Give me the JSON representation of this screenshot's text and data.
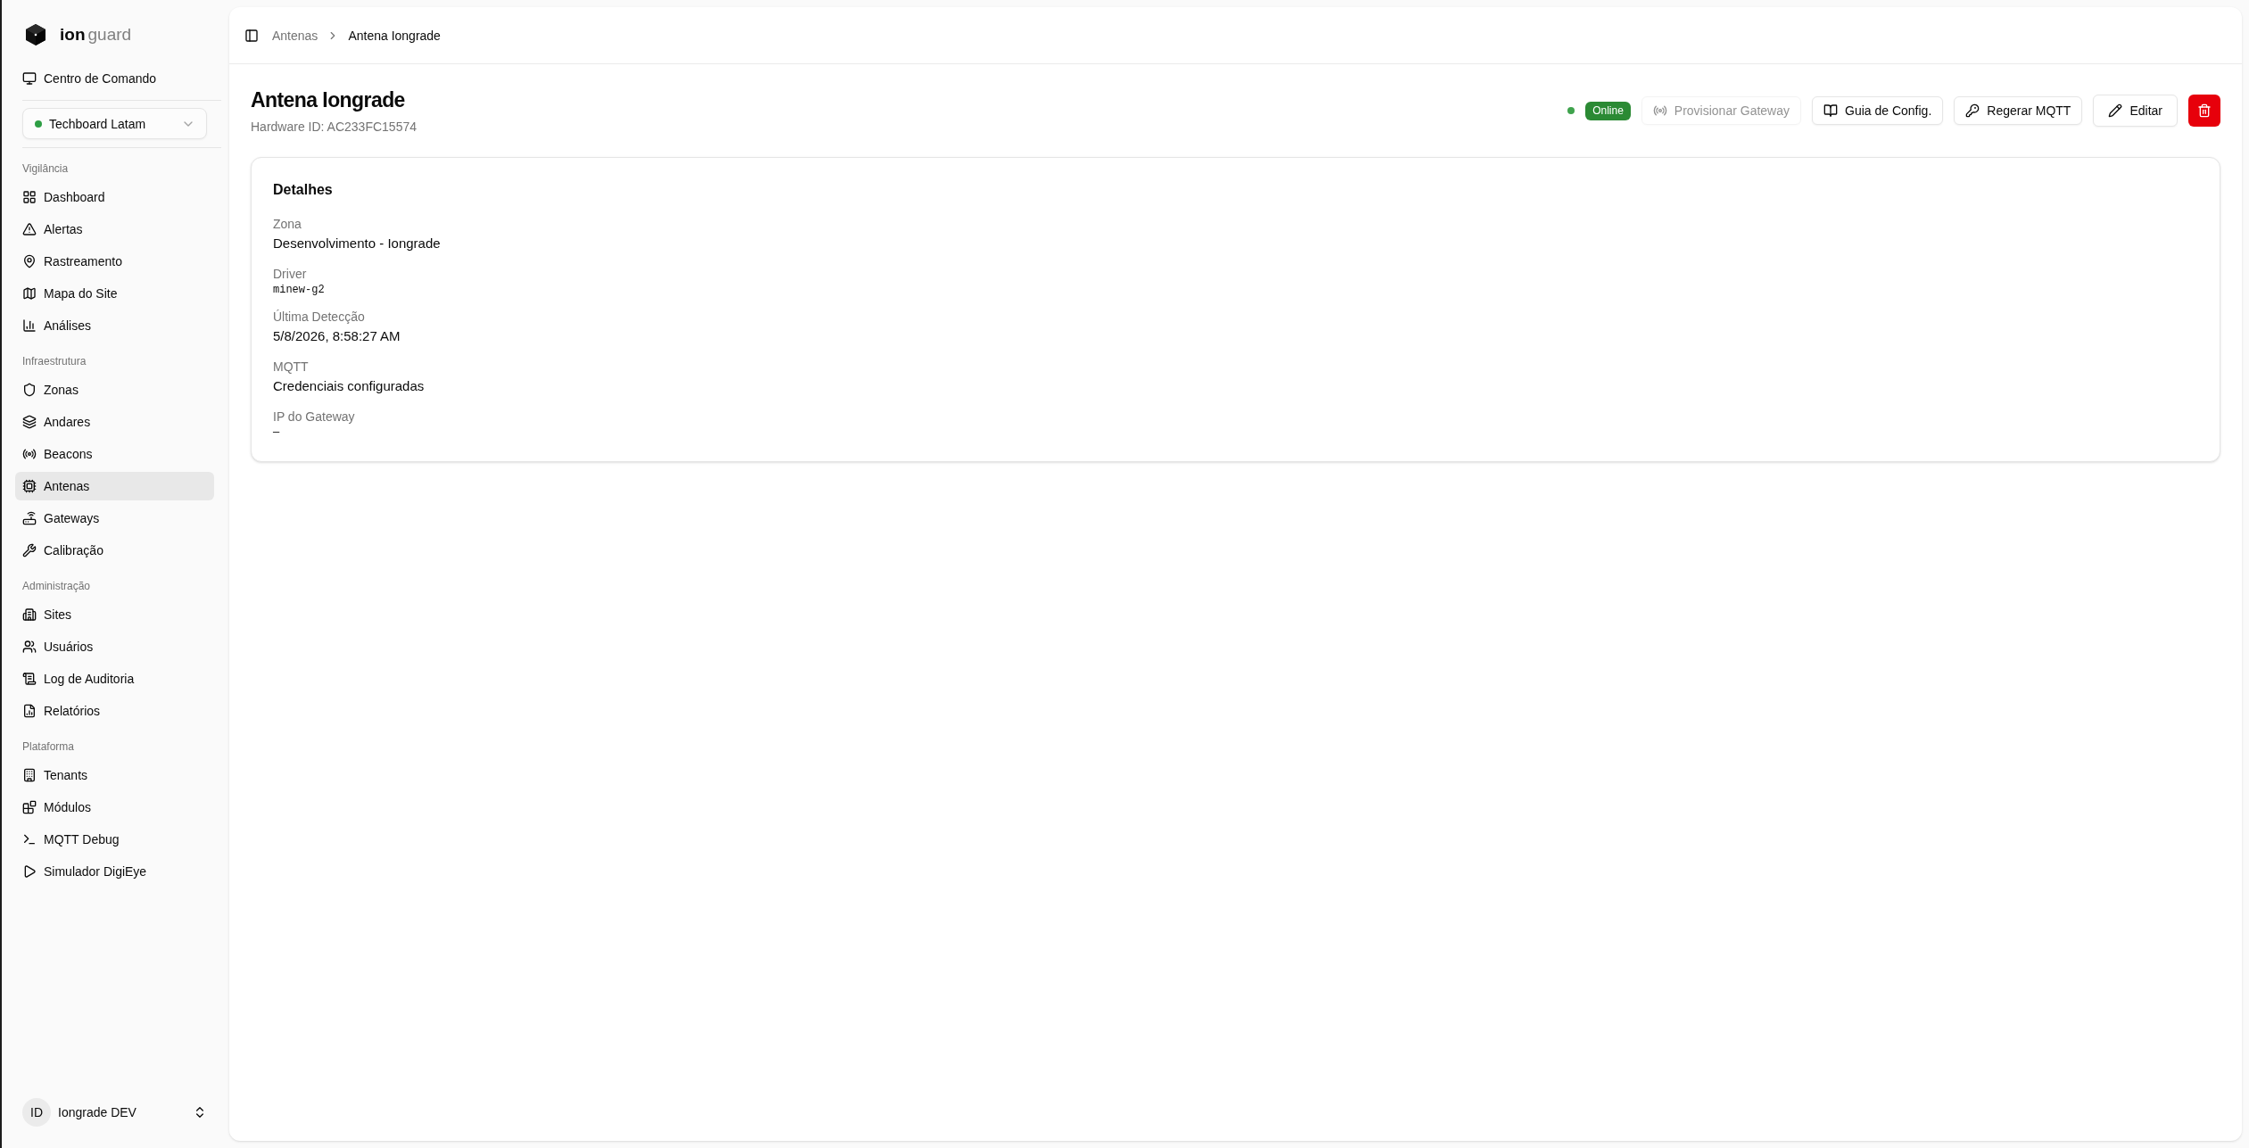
{
  "sidebar": {
    "brand": {
      "prefix": "ion",
      "suffix": "guard"
    },
    "command_center": {
      "label": "Centro de Comando"
    },
    "tenant_select": {
      "value": "Techboard Latam",
      "online": true
    },
    "sections": [
      {
        "title": "Vigilância",
        "items": [
          {
            "label": "Dashboard",
            "selected": false
          },
          {
            "label": "Alertas",
            "selected": false
          },
          {
            "label": "Rastreamento",
            "selected": false
          },
          {
            "label": "Mapa do Site",
            "selected": false
          },
          {
            "label": "Análises",
            "selected": false
          }
        ]
      },
      {
        "title": "Infraestrutura",
        "items": [
          {
            "label": "Zonas",
            "selected": false
          },
          {
            "label": "Andares",
            "selected": false
          },
          {
            "label": "Beacons",
            "selected": false
          },
          {
            "label": "Antenas",
            "selected": true
          },
          {
            "label": "Gateways",
            "selected": false
          },
          {
            "label": "Calibração",
            "selected": false
          }
        ]
      },
      {
        "title": "Administração",
        "items": [
          {
            "label": "Sites",
            "selected": false
          },
          {
            "label": "Usuários",
            "selected": false
          },
          {
            "label": "Log de Auditoria",
            "selected": false
          },
          {
            "label": "Relatórios",
            "selected": false
          }
        ]
      },
      {
        "title": "Plataforma",
        "items": [
          {
            "label": "Tenants",
            "selected": false
          },
          {
            "label": "Módulos",
            "selected": false
          },
          {
            "label": "MQTT Debug",
            "selected": false
          },
          {
            "label": "Simulador DigiEye",
            "selected": false
          }
        ]
      }
    ],
    "user": {
      "initials": "ID",
      "name": "Iongrade DEV"
    }
  },
  "header": {
    "breadcrumb": [
      {
        "label": "Antenas",
        "current": false
      },
      {
        "label": "Antena Iongrade",
        "current": true
      }
    ]
  },
  "page": {
    "title": "Antena Iongrade",
    "subtitle": "Hardware ID: AC233FC15574",
    "status": {
      "label": "Online",
      "online": true
    },
    "actions": [
      {
        "kind": "compact",
        "label": "Provisionar Gateway",
        "disabled": true
      },
      {
        "kind": "compact",
        "label": "Guia de Config.",
        "disabled": false
      },
      {
        "kind": "compact",
        "label": "Regerar MQTT",
        "disabled": false
      },
      {
        "kind": "regular",
        "label": "Editar",
        "disabled": false
      },
      {
        "kind": "danger",
        "disabled": false
      }
    ]
  },
  "details": {
    "title": "Detalhes",
    "fields": [
      {
        "label": "Zona",
        "value": "Desenvolvimento - Iongrade",
        "kind": "text"
      },
      {
        "label": "Driver",
        "value": "minew-g2",
        "kind": "code"
      },
      {
        "label": "Última Detecção",
        "value": "5/8/2026, 8:58:27 AM",
        "kind": "text"
      },
      {
        "label": "MQTT",
        "value": "Credenciais configuradas",
        "kind": "text"
      },
      {
        "label": "IP do Gateway",
        "value": "—",
        "kind": "code"
      }
    ]
  }
}
